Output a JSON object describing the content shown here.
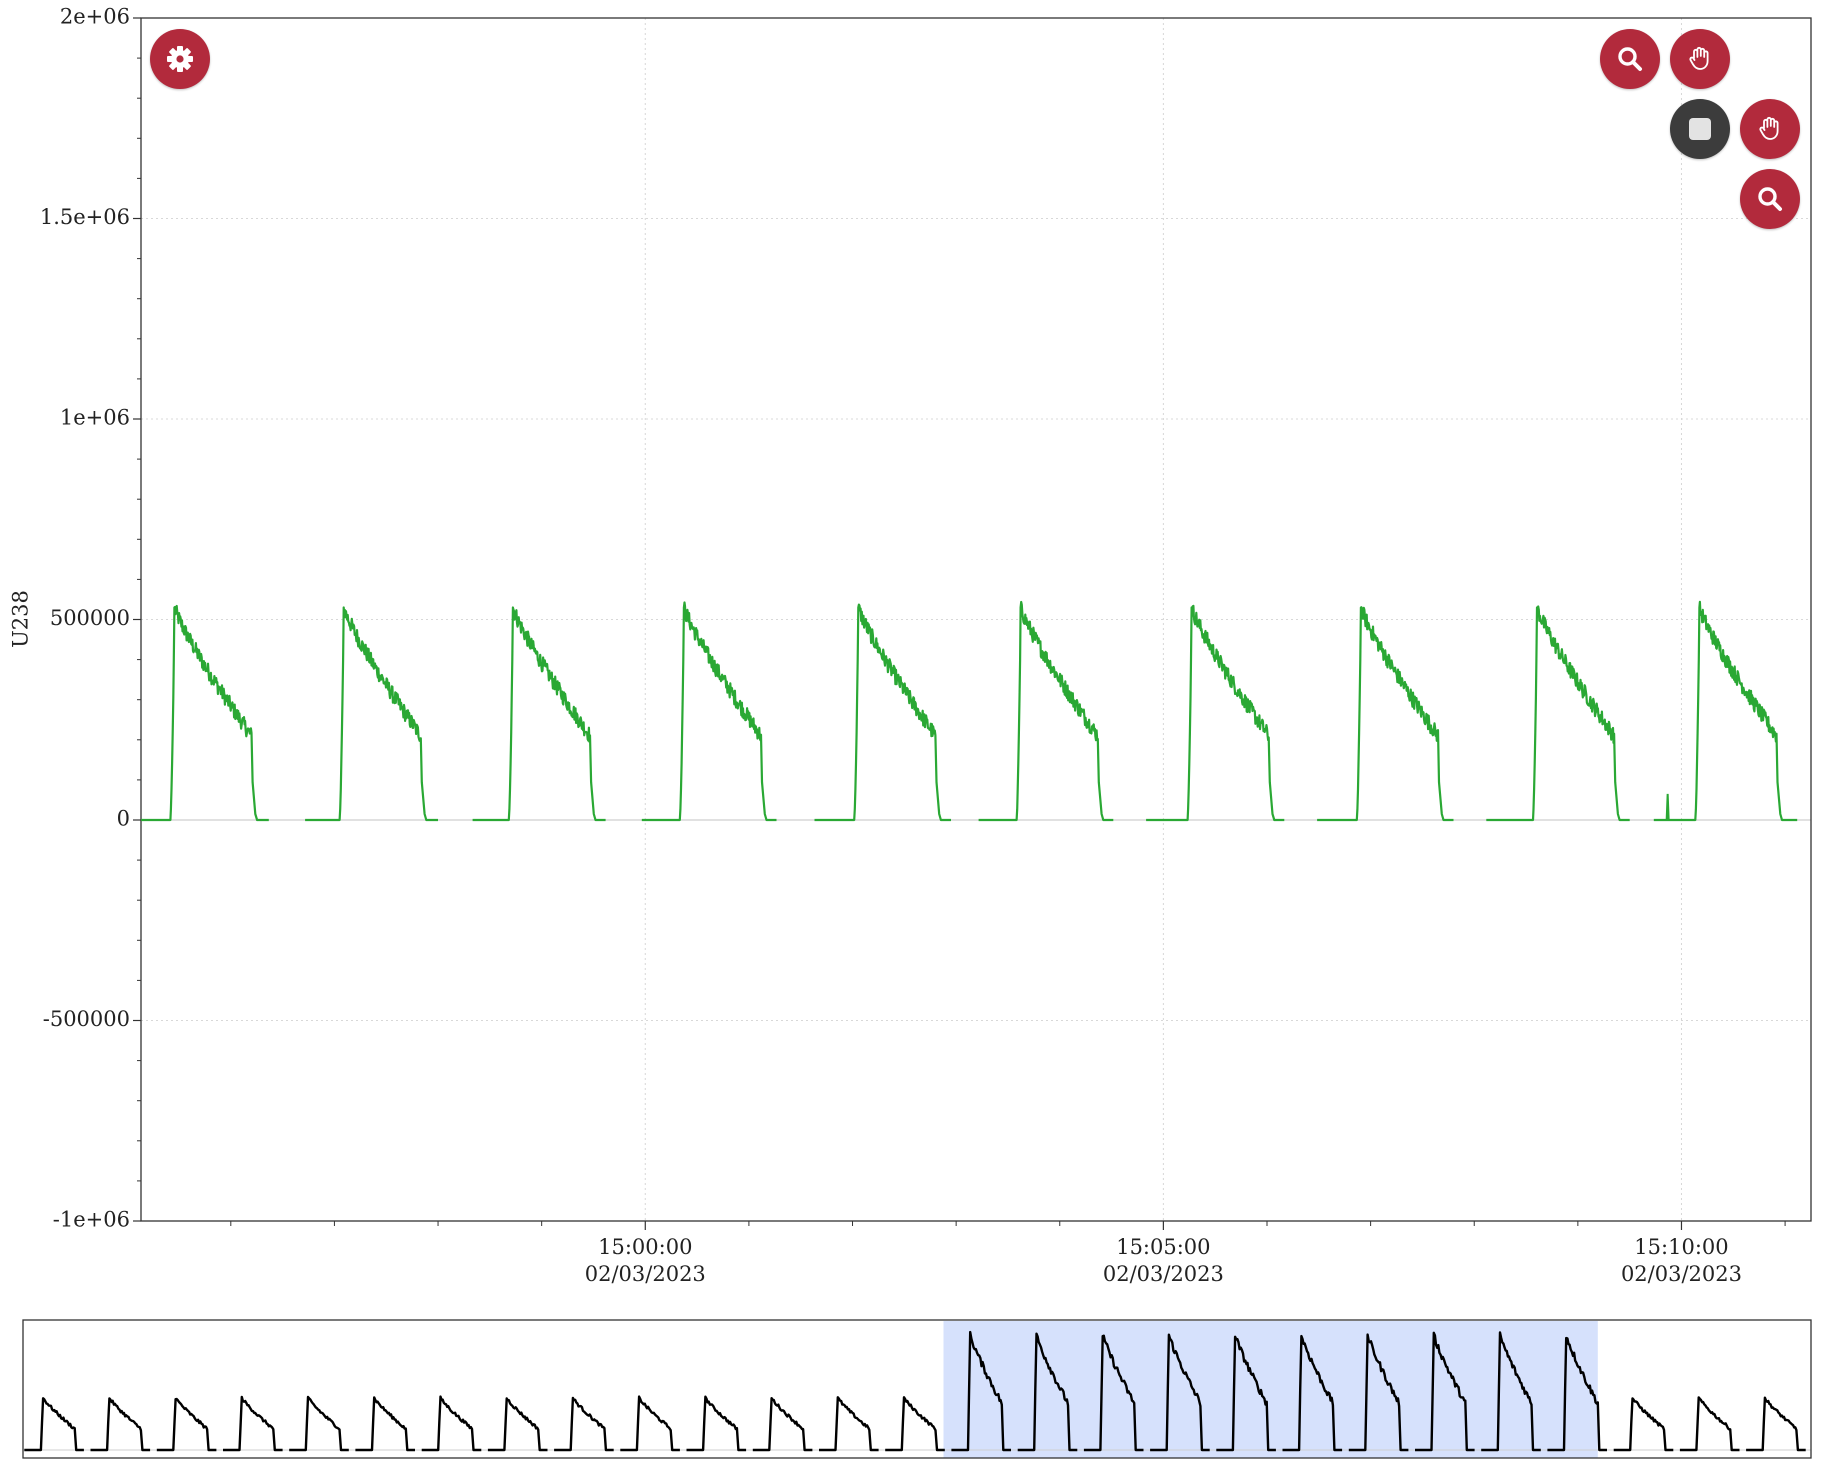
{
  "colors": {
    "series": "#2aa834",
    "navigator_line": "#000000",
    "navigator_selection": "#d6e1fc",
    "button_red": "#b22a3c",
    "button_dark": "#3c3c3c",
    "grid": "#d8d8d8"
  },
  "buttons": {
    "settings": {
      "icon": "gear-icon"
    },
    "zoom_top": {
      "icon": "search-icon"
    },
    "pan_top": {
      "icon": "hand-icon"
    },
    "stop": {
      "icon": "square-stop-icon"
    },
    "pan_second": {
      "icon": "hand-icon"
    },
    "zoom_second": {
      "icon": "search-icon"
    }
  },
  "chart_data": {
    "type": "line",
    "ylabel": "U238",
    "ylim": [
      -1000000,
      2000000
    ],
    "y_ticks": [
      {
        "value": 2000000,
        "label": "2e+06"
      },
      {
        "value": 1500000,
        "label": "1.5e+06"
      },
      {
        "value": 1000000,
        "label": "1e+06"
      },
      {
        "value": 500000,
        "label": "500000"
      },
      {
        "value": 0,
        "label": "0"
      },
      {
        "value": -500000,
        "label": "-500000"
      },
      {
        "value": -1000000,
        "label": "-1e+06"
      }
    ],
    "x_range": [
      "14:55:08",
      "15:11:15"
    ],
    "x_ticks": [
      {
        "time": "15:00:00",
        "date": "02/03/2023"
      },
      {
        "time": "15:05:00",
        "date": "02/03/2023"
      },
      {
        "time": "15:10:00",
        "date": "02/03/2023"
      }
    ],
    "grid": true,
    "series": [
      {
        "pulse_length_s": 47,
        "peak": 530000,
        "tail": 210000,
        "spike": {
          "time": "15:09:52",
          "value": 65000
        },
        "pulses": [
          {
            "gap_start": "14:55:08",
            "start": "14:55:25",
            "end": "14:56:12",
            "gap_end": "14:56:22"
          },
          {
            "gap_start": "14:56:43",
            "start": "14:57:03",
            "end": "14:57:50",
            "gap_end": "14:58:00"
          },
          {
            "gap_start": "14:58:20",
            "start": "14:58:41",
            "end": "14:59:28",
            "gap_end": "14:59:37"
          },
          {
            "gap_start": "14:59:58",
            "start": "15:00:20",
            "end": "15:01:07",
            "gap_end": "15:01:16"
          },
          {
            "gap_start": "15:01:38",
            "start": "15:02:01",
            "end": "15:02:48",
            "gap_end": "15:02:57"
          },
          {
            "gap_start": "15:03:13",
            "start": "15:03:35",
            "end": "15:04:22",
            "gap_end": "15:04:31"
          },
          {
            "gap_start": "15:04:50",
            "start": "15:05:14",
            "end": "15:06:01",
            "gap_end": "15:06:10"
          },
          {
            "gap_start": "15:06:29",
            "start": "15:06:52",
            "end": "15:07:39",
            "gap_end": "15:07:48"
          },
          {
            "gap_start": "15:08:07",
            "start": "15:08:34",
            "end": "15:09:21",
            "gap_end": "15:09:30"
          },
          {
            "gap_start": "15:09:44",
            "start": "15:10:08",
            "end": "15:10:55",
            "gap_end": "15:11:07"
          }
        ]
      }
    ],
    "navigator": {
      "pulse_count": 27,
      "selected_range": [
        "14:55:08",
        "15:11:15"
      ],
      "selected_pulses": [
        14,
        23
      ],
      "small_peak": 240000,
      "large_peak": 530000
    }
  }
}
